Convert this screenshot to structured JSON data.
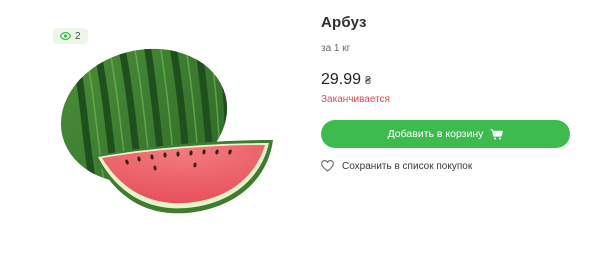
{
  "product": {
    "views_count": "2",
    "views_icon": "eye-icon",
    "title": "Арбуз",
    "unit": "за 1 кг",
    "price": "29.99",
    "currency": "₴",
    "stock_status": "Заканчивается",
    "add_to_cart_label": "Добавить в корзину",
    "cart_icon": "cart-icon",
    "save_label": "Сохранить в список покупок",
    "save_icon": "heart-icon",
    "image": "watermelon-image"
  },
  "colors": {
    "accent_green": "#3dbb4f",
    "badge_bg": "#ecf7ea",
    "stock_red": "#e5484d",
    "text": "#2f2f2f"
  }
}
